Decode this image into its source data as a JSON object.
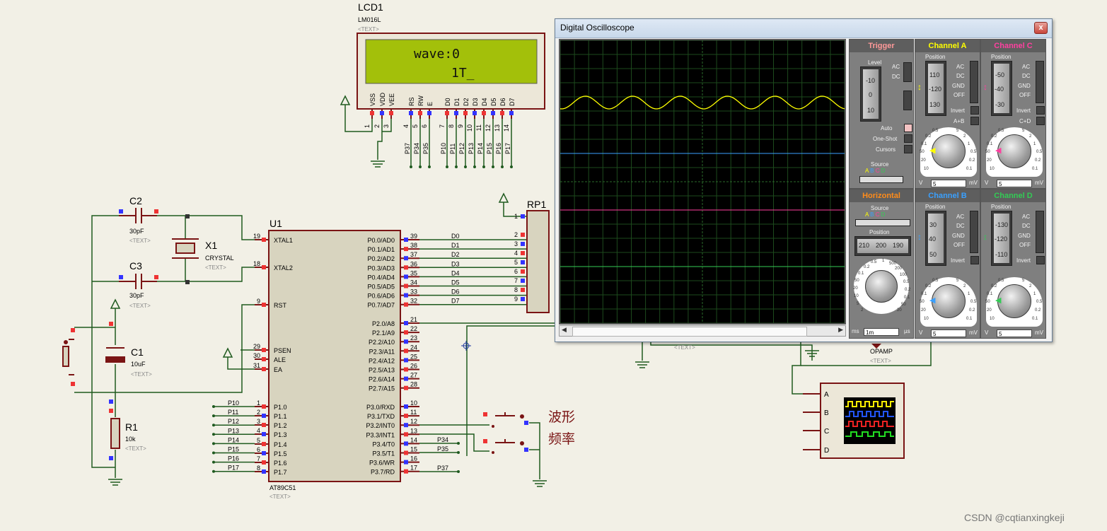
{
  "lcd": {
    "ref": "LCD1",
    "model": "LM016L",
    "text_tag": "<TEXT>",
    "line1": "wave:0",
    "line2": "1T_",
    "pin_labels": [
      "VSS",
      "VDD",
      "VEE",
      "RS",
      "RW",
      "E",
      "D0",
      "D1",
      "D2",
      "D3",
      "D4",
      "D5",
      "D6",
      "D7"
    ],
    "pin_numbers": [
      "1",
      "2",
      "3",
      "4",
      "5",
      "6",
      "7",
      "8",
      "9",
      "10",
      "11",
      "12",
      "13",
      "14"
    ],
    "net_labels": [
      "P37",
      "P34",
      "P35",
      "P10",
      "P11",
      "P12",
      "P13",
      "P14",
      "P15",
      "P16",
      "P17"
    ]
  },
  "mcu": {
    "ref": "U1",
    "part": "AT89C51",
    "text_tag": "<TEXT>",
    "left_pins": [
      {
        "num": "19",
        "name": "XTAL1"
      },
      {
        "num": "18",
        "name": "XTAL2"
      },
      {
        "num": "9",
        "name": "RST"
      },
      {
        "num": "29",
        "name": "PSEN"
      },
      {
        "num": "30",
        "name": "ALE"
      },
      {
        "num": "31",
        "name": "EA"
      },
      {
        "num": "1",
        "name": "P1.0"
      },
      {
        "num": "2",
        "name": "P1.1"
      },
      {
        "num": "3",
        "name": "P1.2"
      },
      {
        "num": "4",
        "name": "P1.3"
      },
      {
        "num": "5",
        "name": "P1.4"
      },
      {
        "num": "6",
        "name": "P1.5"
      },
      {
        "num": "7",
        "name": "P1.6"
      },
      {
        "num": "8",
        "name": "P1.7"
      }
    ],
    "left_nets": [
      "P10",
      "P11",
      "P12",
      "P13",
      "P14",
      "P15",
      "P16",
      "P17"
    ],
    "right_pins": [
      {
        "num": "39",
        "name": "P0.0/AD0"
      },
      {
        "num": "38",
        "name": "P0.1/AD1"
      },
      {
        "num": "37",
        "name": "P0.2/AD2"
      },
      {
        "num": "36",
        "name": "P0.3/AD3"
      },
      {
        "num": "35",
        "name": "P0.4/AD4"
      },
      {
        "num": "34",
        "name": "P0.5/AD5"
      },
      {
        "num": "33",
        "name": "P0.6/AD6"
      },
      {
        "num": "32",
        "name": "P0.7/AD7"
      },
      {
        "num": "21",
        "name": "P2.0/A8"
      },
      {
        "num": "22",
        "name": "P2.1/A9"
      },
      {
        "num": "23",
        "name": "P2.2/A10"
      },
      {
        "num": "24",
        "name": "P2.3/A11"
      },
      {
        "num": "25",
        "name": "P2.4/A12"
      },
      {
        "num": "26",
        "name": "P2.5/A13"
      },
      {
        "num": "27",
        "name": "P2.6/A14"
      },
      {
        "num": "28",
        "name": "P2.7/A15"
      },
      {
        "num": "10",
        "name": "P3.0/RXD"
      },
      {
        "num": "11",
        "name": "P3.1/TXD"
      },
      {
        "num": "12",
        "name": "P3.2/INT0"
      },
      {
        "num": "13",
        "name": "P3.3/INT1"
      },
      {
        "num": "14",
        "name": "P3.4/T0"
      },
      {
        "num": "15",
        "name": "P3.5/T1"
      },
      {
        "num": "16",
        "name": "P3.6/WR"
      },
      {
        "num": "17",
        "name": "P3.7/RD"
      }
    ],
    "bus_nets": [
      "D0",
      "D1",
      "D2",
      "D3",
      "D4",
      "D5",
      "D6",
      "D7"
    ],
    "p3_nets": [
      "P34",
      "P35",
      "P37"
    ]
  },
  "components": {
    "c2": {
      "ref": "C2",
      "value": "30pF",
      "tag": "<TEXT>"
    },
    "c3": {
      "ref": "C3",
      "value": "30pF",
      "tag": "<TEXT>"
    },
    "x1": {
      "ref": "X1",
      "value": "CRYSTAL",
      "tag": "<TEXT>"
    },
    "c1": {
      "ref": "C1",
      "value": "10uF",
      "tag": "<TEXT>"
    },
    "r1": {
      "ref": "R1",
      "value": "10k",
      "tag": "<TEXT>"
    },
    "rp1": {
      "ref": "RP1",
      "pins": [
        "1",
        "2",
        "3",
        "4",
        "5",
        "6",
        "7",
        "8",
        "9"
      ]
    },
    "opamp": {
      "label": "OPAMP",
      "tag": "<TEXT>",
      "tag2": "<TEXT>"
    },
    "buttons": {
      "label1": "波形",
      "label2": "频率"
    },
    "logic": {
      "inputs": [
        "A",
        "B",
        "C",
        "D"
      ]
    }
  },
  "scope": {
    "title": "Digital Oscilloscope",
    "close": "x",
    "trigger": {
      "title": "Trigger",
      "level": "Level",
      "ac": "AC",
      "dc": "DC",
      "auto": "Auto",
      "oneshot": "One-Shot",
      "cursors": "Cursors",
      "source": "Source",
      "src": [
        "A",
        "B",
        "C",
        "D"
      ],
      "ticks": [
        "-10",
        "0",
        "10"
      ]
    },
    "horizontal": {
      "title": "Horizontal",
      "source": "Source",
      "src": [
        "A",
        "B",
        "C",
        "D"
      ],
      "position": "Position",
      "pos_ticks": [
        "210",
        "200",
        "190"
      ],
      "field": "1m",
      "unit_left": "ms",
      "unit_right": "µs"
    },
    "channels": [
      {
        "title": "Channel A",
        "color": "#ffff00",
        "ticks": [
          "110",
          "-120",
          "130"
        ],
        "field": "5",
        "v": "V",
        "mv": "mV",
        "extra": "A+B"
      },
      {
        "title": "Channel C",
        "color": "#ff40a0",
        "ticks": [
          "-50",
          "-40",
          "-30"
        ],
        "field": "5",
        "v": "V",
        "mv": "mV",
        "extra": "C+D"
      },
      {
        "title": "Channel B",
        "color": "#3aa0ff",
        "ticks": [
          "30",
          "40",
          "50"
        ],
        "field": "5",
        "v": "V",
        "mv": "mV",
        "extra": ""
      },
      {
        "title": "Channel D",
        "color": "#33cc55",
        "ticks": [
          "-130",
          "-120",
          "-110"
        ],
        "field": "5",
        "v": "V",
        "mv": "mV",
        "extra": ""
      }
    ],
    "coupling": [
      "AC",
      "DC",
      "GND",
      "OFF"
    ],
    "position_label": "Position",
    "invert": "Invert",
    "knob_scale": [
      "0.5",
      "0.2",
      "0.1",
      "50",
      "20",
      "10",
      "5",
      "2",
      "1",
      "0.5",
      "0.2",
      "0.1",
      "50",
      "20",
      "10",
      "5",
      "2",
      "1"
    ],
    "h_knob_scale": [
      "0.5",
      "0.2",
      "0.1",
      "50",
      "20",
      "10",
      "5",
      "2",
      "1",
      "500",
      "200",
      "100",
      "0.5",
      "0.2",
      "0.1",
      "50",
      "20",
      "10",
      "5",
      "2",
      "1"
    ]
  },
  "watermark": "CSDN @cqtianxingkeji"
}
